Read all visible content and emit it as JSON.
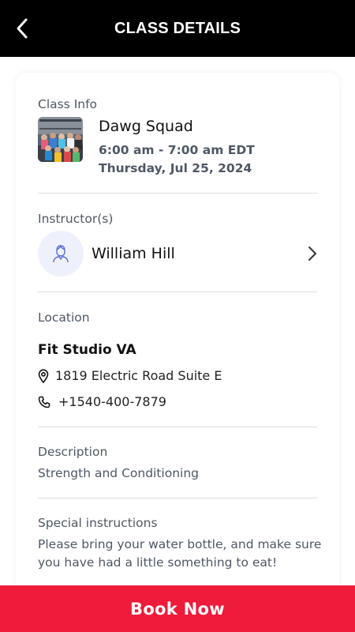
{
  "header": {
    "title": "CLASS DETAILS",
    "back_icon": "chevron-left-icon"
  },
  "class_info": {
    "section_label": "Class Info",
    "name": "Dawg Squad",
    "time": "6:00 am - 7:00 am EDT",
    "date": "Thursday, Jul 25, 2024"
  },
  "instructor": {
    "section_label": "Instructor(s)",
    "name": "William Hill",
    "avatar_icon": "person-icon",
    "chevron_icon": "chevron-right-icon"
  },
  "location": {
    "section_label": "Location",
    "name": "Fit Studio VA",
    "address": "1819 Electric Road Suite E",
    "phone": "+1540-400-7879",
    "address_icon": "map-pin-icon",
    "phone_icon": "phone-icon"
  },
  "description": {
    "section_label": "Description",
    "text": "Strength and Conditioning"
  },
  "special_instructions": {
    "section_label": "Special instructions",
    "text": "Please bring your water bottle, and make sure you have had a little something to eat!"
  },
  "footer": {
    "book_label": "Book Now"
  },
  "colors": {
    "header_bg": "#000000",
    "accent": "#ee1b3a",
    "muted_text": "#4f5865",
    "avatar_bg": "#eef1fb"
  }
}
